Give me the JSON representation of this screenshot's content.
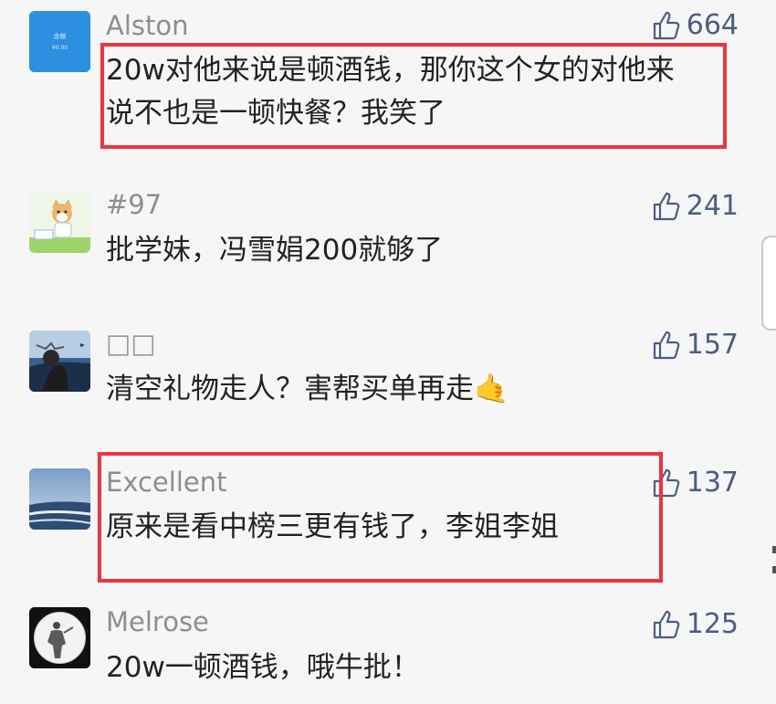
{
  "colors": {
    "background": "#f6f6f6",
    "name": "#8e8e8e",
    "text": "#222222",
    "like": "#4b5d84",
    "highlight": "#ef3340"
  },
  "avatar1": {
    "label": "余额",
    "amount": "¥0.00"
  },
  "comments": [
    {
      "user": "Alston",
      "likes": "664",
      "lines": [
        "20w对他来说是顿酒钱，那你这个女的对他来",
        "说不也是一顿快餐？我笑了"
      ],
      "icon": "thumbs-up-icon"
    },
    {
      "user": "#97",
      "likes": "241",
      "lines": [
        "批学妹，冯雪娟200就够了"
      ],
      "icon": "thumbs-up-icon"
    },
    {
      "user": "□□",
      "likes": "157",
      "lines": [
        "清空礼物走人？害帮买单再走"
      ],
      "emoji": "🤙",
      "icon": "thumbs-up-icon"
    },
    {
      "user": "Excellent",
      "likes": "137",
      "lines": [
        "原来是看中榜三更有钱了，李姐李姐"
      ],
      "icon": "thumbs-up-icon"
    },
    {
      "user": "Melrose",
      "likes": "125",
      "lines": [
        "20w一顿酒钱，哦牛批！"
      ],
      "icon": "thumbs-up-icon"
    }
  ]
}
